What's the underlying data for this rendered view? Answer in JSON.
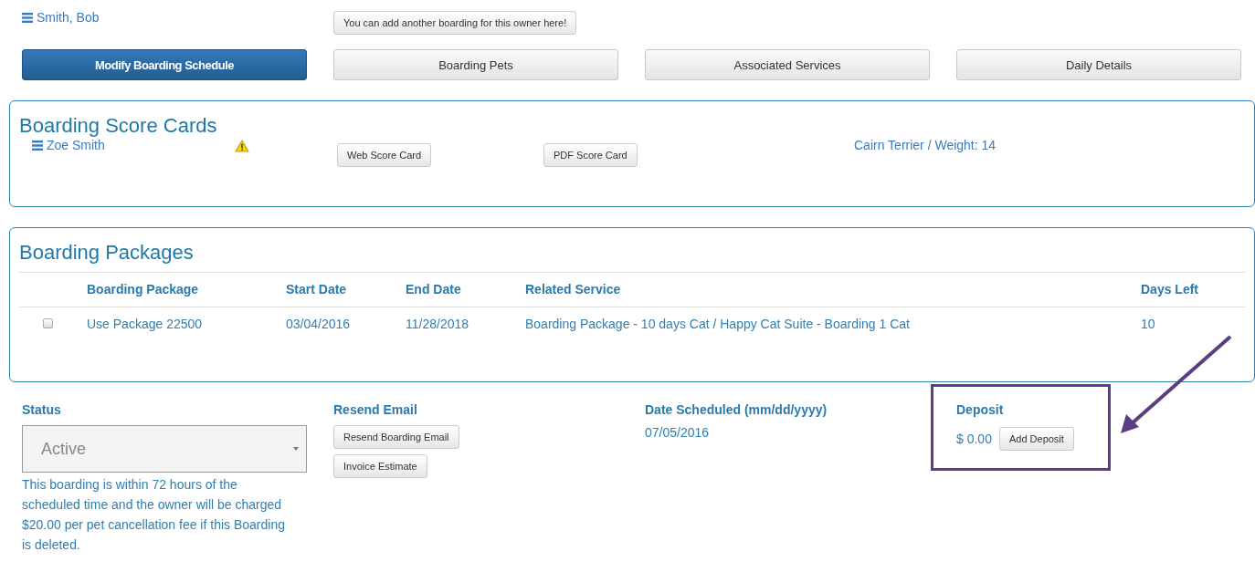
{
  "owner": {
    "name": "Smith, Bob",
    "add_button": "You can add another boarding for this owner here!"
  },
  "tabs": [
    {
      "label": "Modify Boarding Schedule",
      "selected": true
    },
    {
      "label": "Boarding Pets",
      "selected": false
    },
    {
      "label": "Associated Services",
      "selected": false
    },
    {
      "label": "Daily Details",
      "selected": false
    }
  ],
  "score_cards": {
    "title": "Boarding Score Cards",
    "pet": {
      "name": "Zoe Smith",
      "warning": true,
      "web_button": "Web Score Card",
      "pdf_button": "PDF Score Card",
      "details": "Cairn Terrier / Weight: 14"
    }
  },
  "packages": {
    "title": "Boarding Packages",
    "columns": [
      "Boarding Package",
      "Start Date",
      "End Date",
      "Related Service",
      "Days Left"
    ],
    "rows": [
      {
        "checked": false,
        "cells": [
          "Use Package 22500",
          "03/04/2016",
          "11/28/2018",
          "Boarding Package - 10 days Cat / Happy Cat Suite - Boarding 1 Cat",
          "10"
        ]
      }
    ]
  },
  "status": {
    "label": "Status",
    "value": "Active",
    "note": "This boarding is within 72 hours of the scheduled time and the owner will be charged $20.00 per pet cancellation fee if this Boarding is deleted."
  },
  "resend": {
    "label": "Resend Email",
    "buttons": [
      "Resend Boarding Email",
      "Invoice Estimate"
    ]
  },
  "date_scheduled": {
    "label": "Date Scheduled (mm/dd/yyyy)",
    "value": "07/05/2016"
  },
  "deposit": {
    "label": "Deposit",
    "amount": "$ 0.00",
    "button": "Add Deposit",
    "highlighted": true
  }
}
